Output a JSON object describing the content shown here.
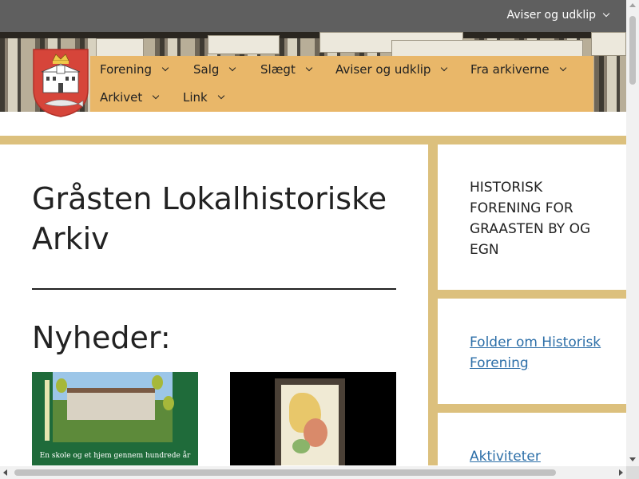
{
  "topbar": {
    "link_label": "Aviser og udklip"
  },
  "nav": {
    "items": [
      {
        "label": "Forening"
      },
      {
        "label": "Salg"
      },
      {
        "label": "Slægt"
      },
      {
        "label": "Aviser og udklip"
      },
      {
        "label": "Fra arkiverne"
      },
      {
        "label": "Arkivet"
      },
      {
        "label": "Link"
      }
    ]
  },
  "main": {
    "title": "Gråsten Lokalhistoriske Arkiv",
    "news_heading": "Nyheder:",
    "news": [
      {
        "caption": "En skole og et hjem gennem hundrede år"
      },
      {
        "caption": ""
      }
    ]
  },
  "sidebar": {
    "heading": "HISTORISK FORENING FOR GRAASTEN BY OG EGN",
    "links": [
      {
        "label": "Folder om Historisk Forening"
      },
      {
        "label": "Aktiviteter"
      }
    ]
  },
  "colors": {
    "topbar": "#5f5f5f",
    "nav_bg": "#e9b769",
    "accent_stripe": "#dcc07d",
    "link": "#2d6fa8"
  }
}
